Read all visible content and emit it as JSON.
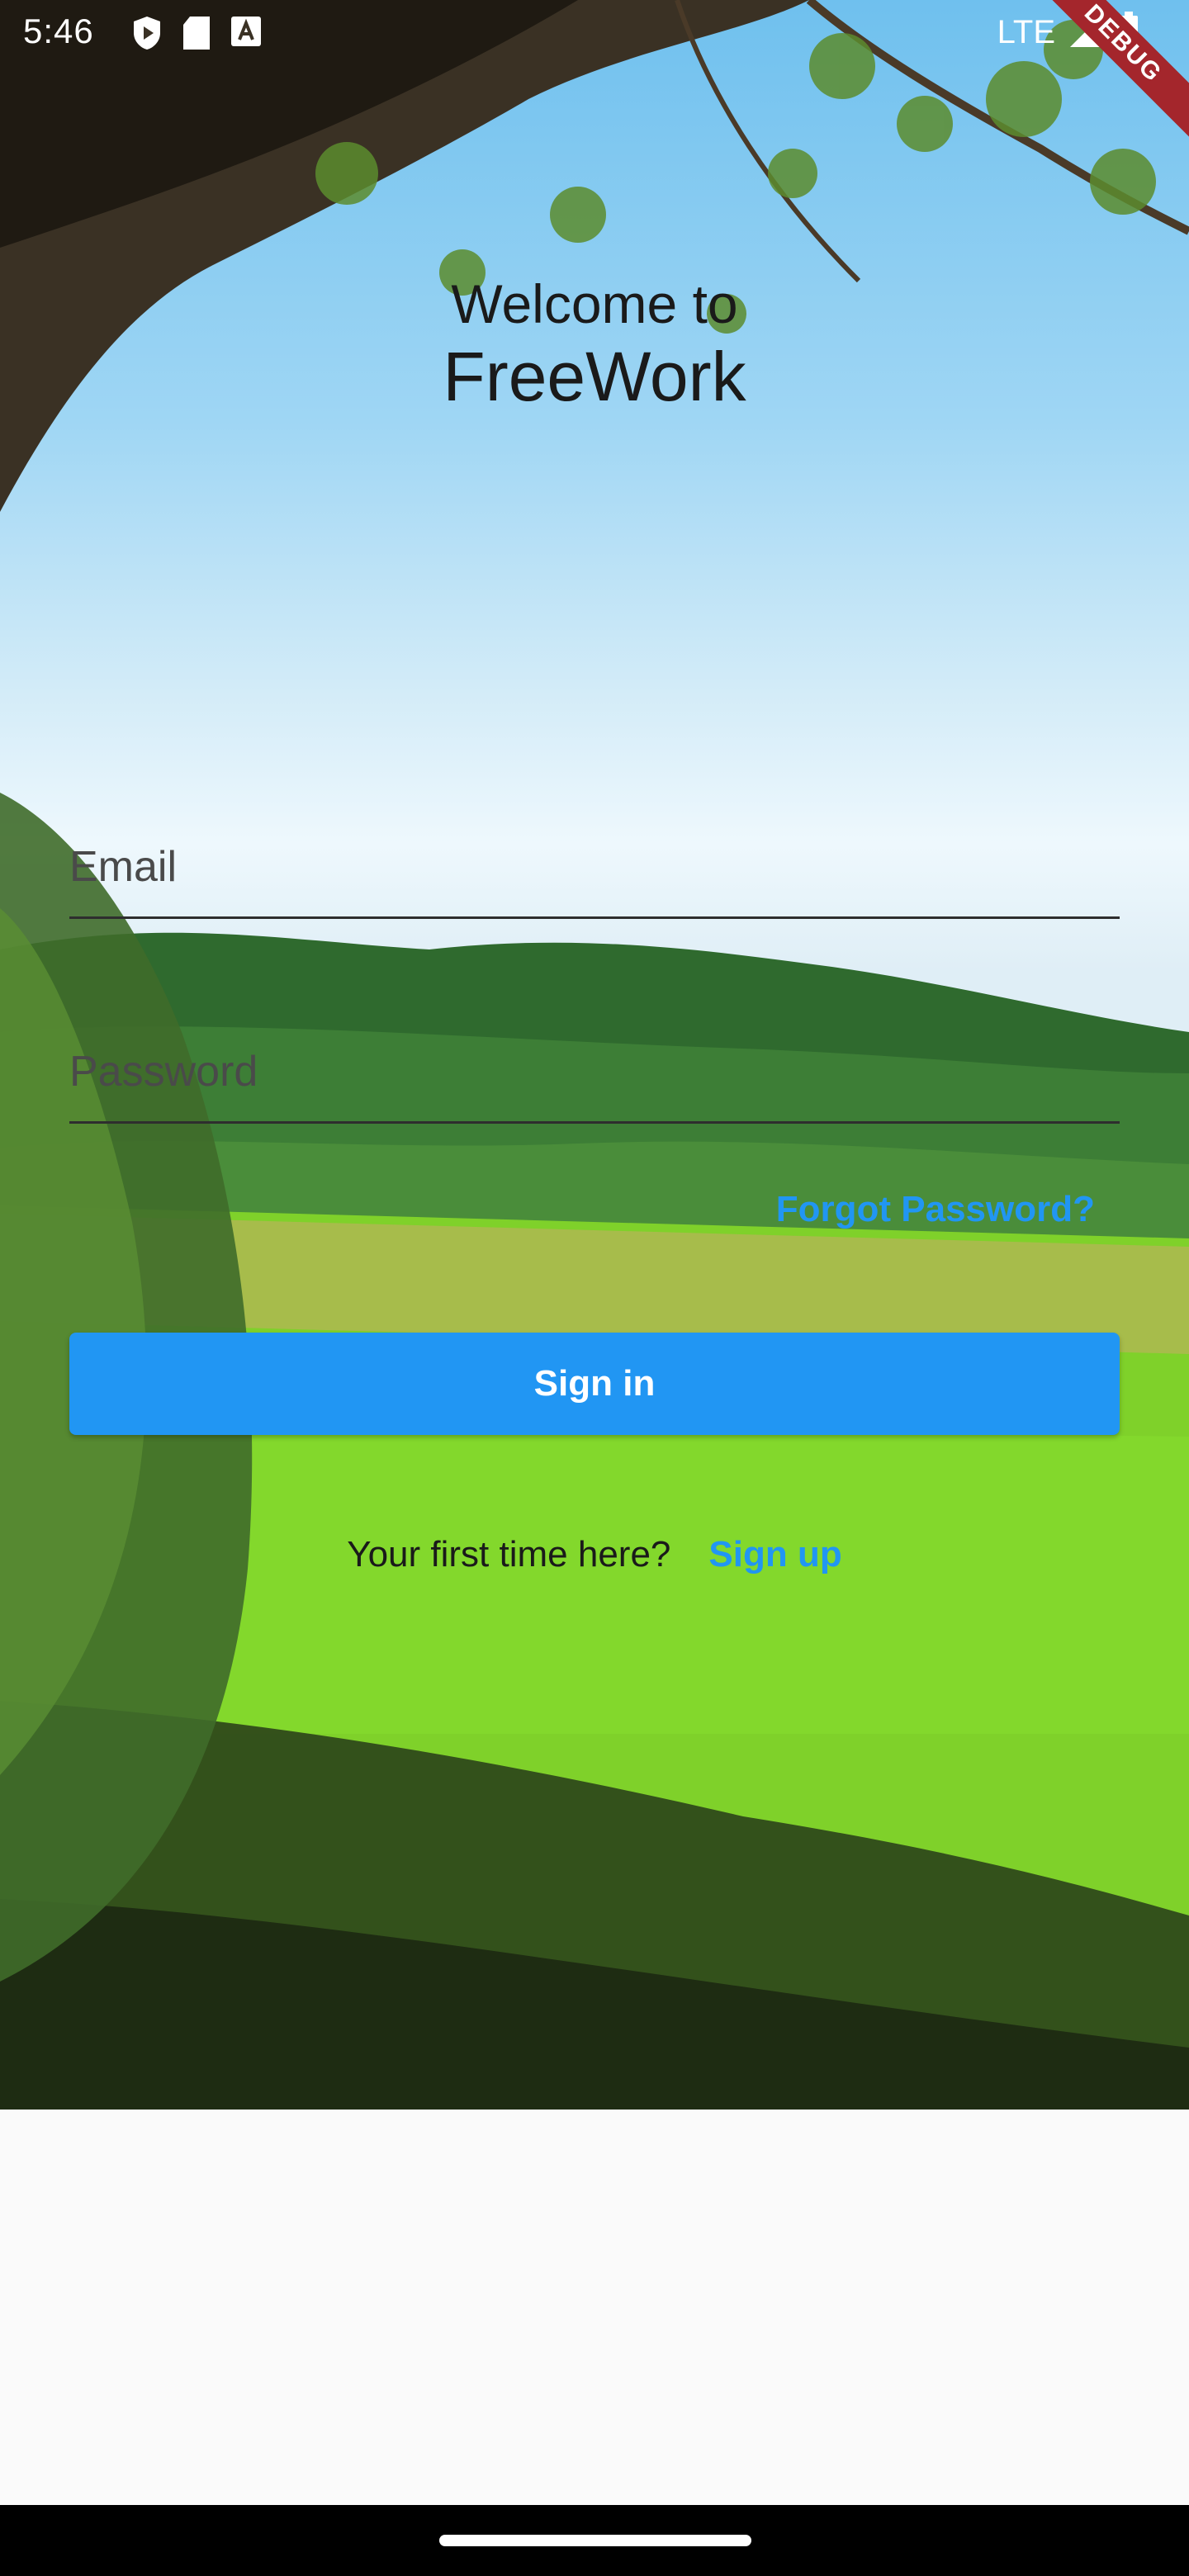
{
  "status_bar": {
    "time": "5:46",
    "network": "LTE",
    "icons": [
      "shield-play-icon",
      "sd-card-icon",
      "keyboard-a-icon",
      "signal-icon",
      "battery-icon"
    ]
  },
  "debug_banner": "DEBUG",
  "heading": {
    "welcome": "Welcome to",
    "app_name": "FreeWork"
  },
  "form": {
    "email_placeholder": "Email",
    "email_value": "",
    "password_placeholder": "Password",
    "password_value": "",
    "forgot_password": "Forgot Password?",
    "sign_in": "Sign in",
    "signup_prompt": "Your first time here?",
    "signup_link": "Sign up"
  },
  "colors": {
    "accent": "#2196f3",
    "debug": "#a4262c",
    "page_background": "#fafafa"
  }
}
